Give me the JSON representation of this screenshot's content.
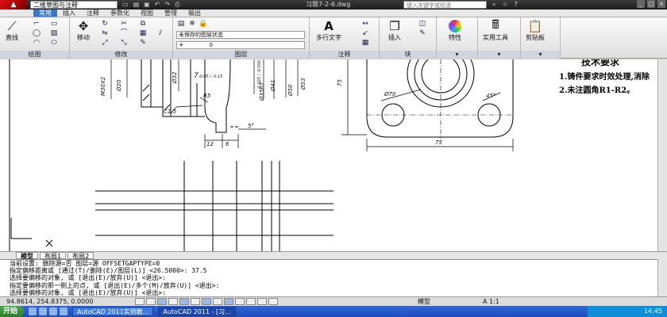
{
  "titlebar": {
    "workspace": "二维草图与注释",
    "document": "习题7-2-6.dwg",
    "search_placeholder": "键入关键字或短语"
  },
  "ribbon_tabs": [
    "常用",
    "插入",
    "注释",
    "参数化",
    "视图",
    "管理",
    "输出"
  ],
  "ribbon": {
    "draw_panel": {
      "label": "绘图",
      "line_label": "直线"
    },
    "modify_panel": {
      "label": "修改",
      "move_label": "移动"
    },
    "layers_panel": {
      "label": "图层",
      "layer_state": "未保存的图层状态",
      "current_layer": "0"
    },
    "annotation_panel": {
      "label": "注释",
      "mtext_label": "多行文字"
    },
    "block_panel": {
      "label": "块",
      "insert_label": "插入"
    },
    "properties_label": "特性",
    "utilities_label": "实用工具",
    "clipboard_label": "剪贴板"
  },
  "drawing": {
    "tech_req": {
      "title": "技术要求",
      "line1": "1.铸件要求时效处理,消除",
      "line2": "2.未注圆角R1-R2。"
    },
    "dims": {
      "m30": "M30X2",
      "d20": "Ø20",
      "d32": "Ø32",
      "d7": "7",
      "d7_tol": "-0.05 / -0.15",
      "tol1": "-0.025 / -0.050",
      "d35": "Ø35h7",
      "d41": "Ø41",
      "d50": "Ø50",
      "d53": "Ø53",
      "r5": "R5",
      "c15": "C1.5",
      "d12": "12",
      "d6": "6",
      "ang": "5°",
      "d70": "Ø70",
      "ang45": "45°",
      "h75": "75",
      "w75": "75"
    }
  },
  "layout_tabs": [
    "模型",
    "布局1",
    "布局2"
  ],
  "command_lines": [
    "当前设置: 删除源=否  图层=源  OFFSETGAPTYPE=0",
    "指定偏移距离或 [通过(T)/删除(E)/图层(L)] <26.5000>:  37.5",
    "选择要偏移的对象, 或 [退出(E)/放弃(U)] <退出>:",
    "指定要偏移的那一侧上的点, 或 [退出(E)/多个(M)/放弃(U)] <退出>:",
    "选择要偏移的对象, 或 [退出(E)/放弃(U)] <退出>:"
  ],
  "status": {
    "coords": "94.8614, 254.8375, 0.0000",
    "model": "模型",
    "scale": "A 1:1"
  },
  "taskbar": {
    "start": "开始",
    "task1": "AutoCAD 2011实例教...",
    "task2": "AutoCAD 2011 - [习...",
    "clock": "14:45"
  }
}
